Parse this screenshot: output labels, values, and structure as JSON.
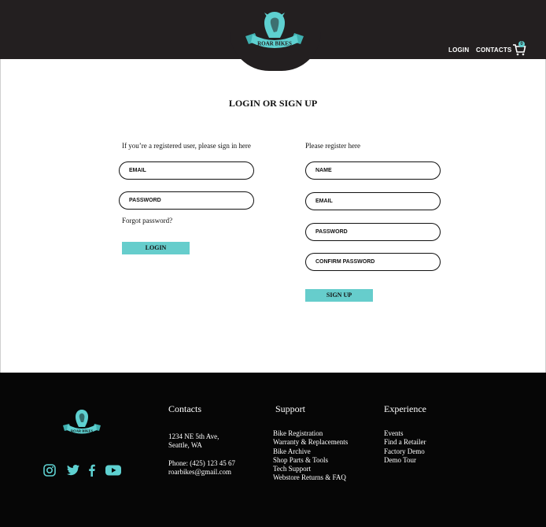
{
  "brand": {
    "name": "ROAR BIKES",
    "accent_color": "#5ed0d0",
    "dark_color": "#231f20"
  },
  "header": {
    "nav": [
      {
        "label": "LOGIN"
      },
      {
        "label": "CONTACTS"
      }
    ],
    "cart": {
      "icon": "cart-icon",
      "count": "0"
    }
  },
  "page": {
    "title": "LOGIN OR SIGN UP"
  },
  "login": {
    "intro": "If you’re a registered user, please sign in here",
    "email_placeholder": "EMAIL",
    "password_placeholder": "PASSWORD",
    "forgot_label": "Forgot password?",
    "button_label": "LOGIN"
  },
  "register": {
    "intro": "Please register here",
    "name_placeholder": "NAME",
    "email_placeholder": "EMAIL",
    "password_placeholder": "PASSWORD",
    "confirm_placeholder": "CONFIRM PASSWORD",
    "button_label": "SIGN UP"
  },
  "footer": {
    "social_icons": [
      "instagram-icon",
      "twitter-icon",
      "facebook-icon",
      "youtube-icon"
    ],
    "contacts": {
      "title": "Contacts",
      "address_line1": "1234 NE 5th Ave,",
      "address_line2": "Seattle, WA",
      "phone": "Phone: (425) 123 45 67",
      "email": "roarbikes@gmail.com"
    },
    "support": {
      "title": "Support",
      "links": [
        "Bike Registration",
        "Warranty & Replacements",
        "Bike Archive",
        "Shop Parts & Tools",
        "Tech Support",
        "Webstore Returns & FAQ"
      ]
    },
    "experience": {
      "title": "Experience",
      "links": [
        "Events",
        "Find a Retailer",
        "Factory Demo",
        "Demo Tour"
      ]
    }
  }
}
